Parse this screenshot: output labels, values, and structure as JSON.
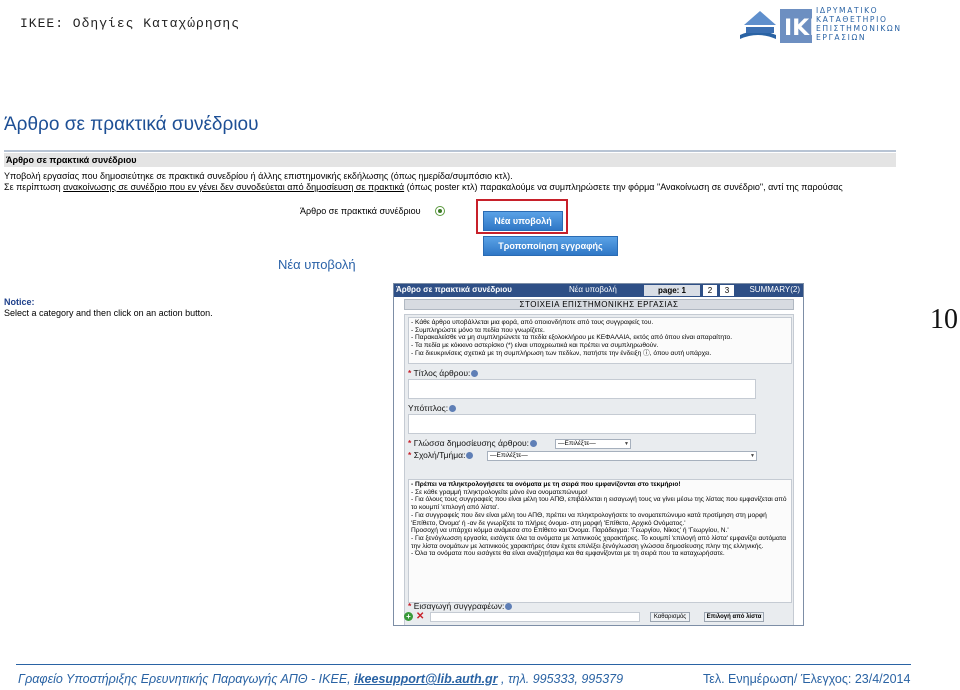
{
  "slide": {
    "title": "IKEE: Οδηγίες Καταχώρησης",
    "logo_text": [
      "ΙΔΡΥΜΑΤΙΚΟ",
      "ΚΑΤΑΘΕΤΗΡΙΟ",
      "ΕΠΙΣΤΗΜΟΝΙΚΩΝ",
      "ΕΡΓΑΣΙΩΝ"
    ],
    "page_number": "10"
  },
  "screenshot": {
    "title": "Άρθρο σε πρακτικά συνέδριου",
    "section_bar": "Άρθρο σε πρακτικά συνέδριου",
    "intro_line1": "Υποβολή εργασίας που δημοσιεύτηκε σε πρακτικά συνεδρίου ή άλλης επιστημονικής εκδήλωσης (όπως ημερίδα/συμπόσιο κτλ).",
    "intro_line2_pre": "Σε περίπτωση ",
    "intro_line2_link": "ανακοίνωσης σε συνέδριο που εν γένει δεν συνοδεύεται από δημοσίευση σε πρακτικά",
    "intro_line2_post": " (όπως poster κτλ) παρακαλούμε να συμπληρώσετε την φόρμα \"Ανακοίνωση σε συνέδριο\", αντί της παρούσας",
    "radio_label": "Άρθρο σε πρακτικά συνέδριου",
    "new_submission_button": "Νέα υποβολή",
    "edit_record_button": "Τροποποίηση εγγραφής",
    "new_submission_heading": "Νέα υποβολή",
    "notice_heading": "Notice:",
    "notice_text": "Select a category and then click on an action button."
  },
  "form": {
    "header_title": "Άρθρο σε πρακτικά συνέδριου",
    "header_mode": "Νέα υποβολή",
    "page_label": "page: 1",
    "page2": "2",
    "page3": "3",
    "summary_label": "SUMMARY(2)",
    "section_title": "ΣΤΟΙΧΕΙΑ ΕΠΙΣΤΗΜΟΝΙΚΗΣ ΕΡΓΑΣΙΑΣ",
    "instructions_a": [
      "- Κάθε άρθρο υποβάλλεται μια φορά, από οποιονδήποτε από τους συγγραφείς του.",
      "- Συμπληρώστε μόνο τα πεδία που γνωρίζετε.",
      "- Παρακαλείσθε να μη συμπληρώνετε τα πεδία εξολοκλήρου με ΚΕΦΑΛΑΙΑ, εκτός από όπου είναι απαραίτητο.",
      "- Τα πεδία με κόκκινο αστερίσκο (*) είναι υποχρεωτικά και πρέπει να συμπληρωθούν.",
      "- Για διευκρινίσεις σχετικά με τη συμπλήρωση των πεδίων, πατήστε την ένδειξη ⓘ, όπου αυτή υπάρχει."
    ],
    "label_title": "Τίτλος άρθρου:",
    "label_subtitle": "Υπότιτλος:",
    "label_language": "Γλώσσα δημοσίευσης άρθρου:",
    "language_value": "—Επιλέξτε—",
    "label_school": "Σχολή/Τμήμα:",
    "school_value": "—Επιλέξτε—",
    "instructions_b": [
      "- Πρέπει να πληκτρολογήσετε τα ονόματα με τη σειρά που εμφανίζονται στο τεκμήριο!",
      "- Σε κάθε γραμμή πληκτρολογείτε μόνο ένα ονοματεπώνυμο!",
      "- Για όλους τους συγγραφείς που είναι μέλη του ΑΠΘ, επιβάλλεται η εισαγωγή τους να γίνει μέσω της λίστας που εμφανίζεται από το κουμπί 'επιλογή από λίστα'.",
      "- Για συγγραφείς που δεν είναι μέλη του ΑΠΘ, πρέπει να πληκτρολογήσετε το ονοματεπώνυμο κατά προτίμηση στη μορφή 'Επίθετο, Όνομα' ή -αν δε γνωρίζετε το πλήρες όνομα- στη μορφή 'Επίθετο, Αρχικό Ονόματος.'",
      "Προσοχή να υπάρχει κόμμα ανάμεσα στο Επίθετο και Όνομα. Παράδειγμα: 'Γεωργίου, Νίκος' ή 'Γεωργίου, Ν.'",
      "- Για ξενόγλωσση εργασία, εισάγετε όλα τα ονόματα με λατινικούς χαρακτήρες. Το κουμπί 'επιλογή από λίστα' εμφανίζει αυτόματα την λίστα ονομάτων με λατινικούς χαρακτήρες όταν έχετε επιλέξει ξενόγλωσση γλώσσα δημοσίευσης πλην της ελληνικής.",
      "- Όλα τα ονόματα που εισάγετε θα είναι αναζητήσιμα και θα εμφανίζονται με τη σειρά που τα καταχωρήσατε."
    ],
    "label_authors": "Εισαγωγή συγγραφέων:",
    "clear_button": "Καθαρισμός",
    "pick_button": "Επιλογή από λίστα"
  },
  "footer": {
    "left_pre": "Γραφείο Υποστήριξης Ερευνητικής Παραγωγής ΑΠΘ - IKEE, ",
    "email": "ikeesupport@lib.auth.gr",
    "left_post": " , τηλ. 995333, 995379",
    "right": "Τελ. Ενημέρωση/ Έλεγχος: 23/4/2014"
  },
  "colors": {
    "accent_blue": "#2a63a4",
    "highlight_red": "#c7202a"
  }
}
